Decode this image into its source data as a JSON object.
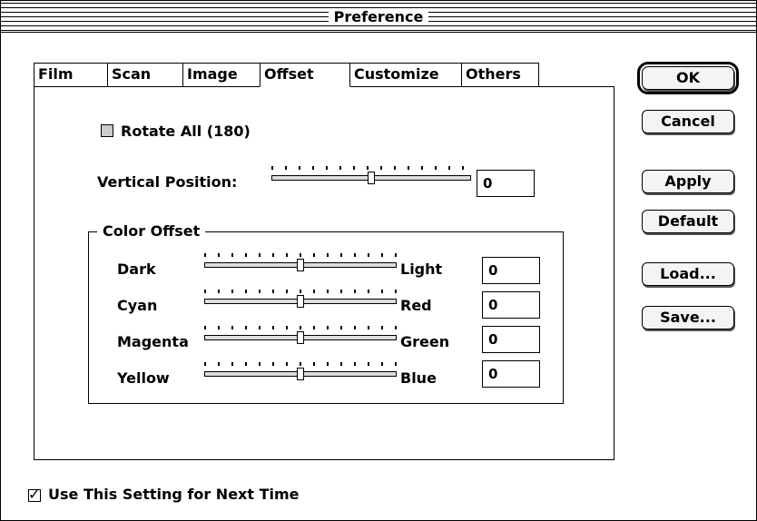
{
  "window": {
    "title": "Preference"
  },
  "tabs": [
    "Film",
    "Scan",
    "Image",
    "Offset",
    "Customize",
    "Others"
  ],
  "offset": {
    "rotate_all": {
      "label": "Rotate All (180)",
      "checked": false
    },
    "vertical_position": {
      "label": "Vertical Position:",
      "value": "0",
      "slider_fraction": 0.5
    },
    "color_offset": {
      "title": "Color Offset",
      "rows": [
        {
          "left": "Dark",
          "right": "Light",
          "value": "0",
          "slider_fraction": 0.5
        },
        {
          "left": "Cyan",
          "right": "Red",
          "value": "0",
          "slider_fraction": 0.5
        },
        {
          "left": "Magenta",
          "right": "Green",
          "value": "0",
          "slider_fraction": 0.5
        },
        {
          "left": "Yellow",
          "right": "Blue",
          "value": "0",
          "slider_fraction": 0.5
        }
      ]
    }
  },
  "buttons": {
    "ok": "OK",
    "cancel": "Cancel",
    "apply": "Apply",
    "default": "Default",
    "load": "Load...",
    "save": "Save..."
  },
  "footer": {
    "use_setting": {
      "label": "Use This Setting for Next Time",
      "checked": true
    }
  }
}
